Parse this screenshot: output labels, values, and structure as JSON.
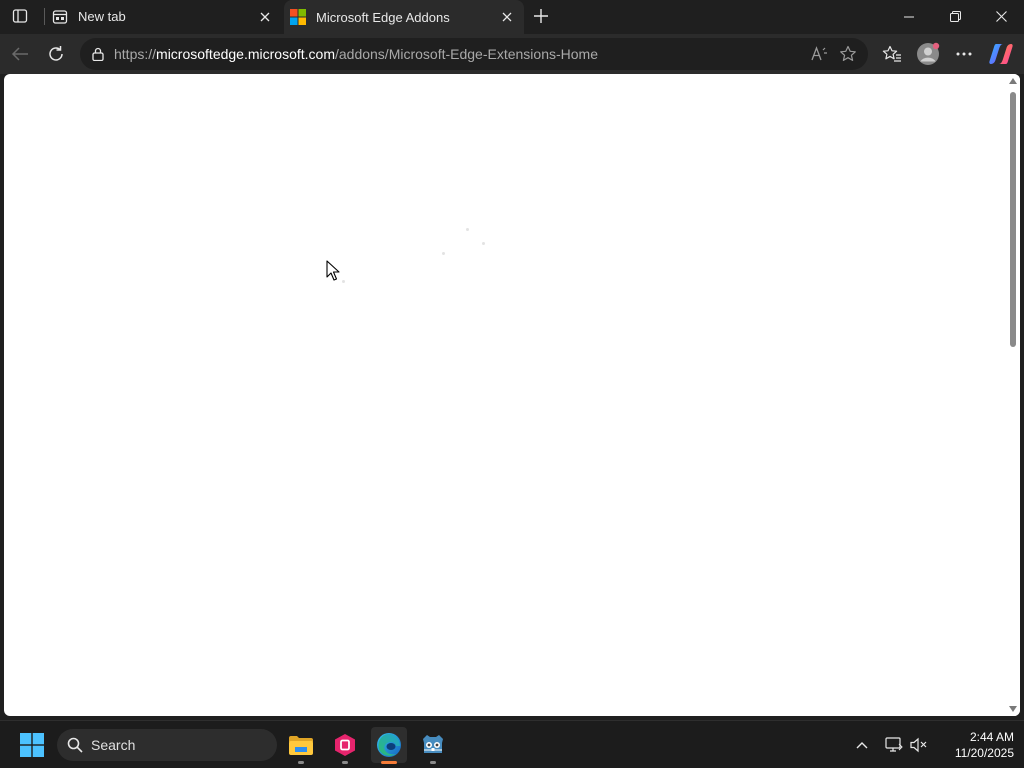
{
  "browser": {
    "tabs": [
      {
        "title": "New tab",
        "icon": "newtab-icon",
        "active": false
      },
      {
        "title": "Microsoft Edge Addons",
        "icon": "microsoft-logo-icon",
        "active": true
      }
    ],
    "address_bar": {
      "url_prefix": "https://",
      "url_host": "microsoftedge.microsoft.com",
      "url_path": "/addons/Microsoft-Edge-Extensions-Home"
    }
  },
  "taskbar": {
    "search_label": "Search",
    "apps": [
      {
        "name": "File Explorer",
        "icon": "folder-icon"
      },
      {
        "name": "App",
        "icon": "pink-app-icon"
      },
      {
        "name": "Microsoft Edge",
        "icon": "edge-icon",
        "active": true
      },
      {
        "name": "Godot",
        "icon": "godot-icon"
      }
    ],
    "time": "2:44 AM",
    "date": "11/20/2025"
  },
  "colors": {
    "chrome_bg": "#1f1f1f",
    "toolbar_bg": "#2b2b2b",
    "active_indicator": "#f57c38"
  }
}
